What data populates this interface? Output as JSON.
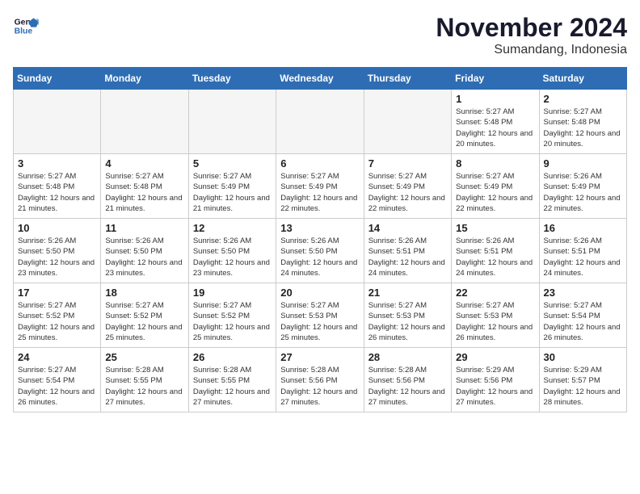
{
  "logo": {
    "line1": "General",
    "line2": "Blue"
  },
  "title": "November 2024",
  "subtitle": "Sumandang, Indonesia",
  "weekdays": [
    "Sunday",
    "Monday",
    "Tuesday",
    "Wednesday",
    "Thursday",
    "Friday",
    "Saturday"
  ],
  "weeks": [
    [
      {
        "day": "",
        "info": ""
      },
      {
        "day": "",
        "info": ""
      },
      {
        "day": "",
        "info": ""
      },
      {
        "day": "",
        "info": ""
      },
      {
        "day": "",
        "info": ""
      },
      {
        "day": "1",
        "info": "Sunrise: 5:27 AM\nSunset: 5:48 PM\nDaylight: 12 hours\nand 20 minutes."
      },
      {
        "day": "2",
        "info": "Sunrise: 5:27 AM\nSunset: 5:48 PM\nDaylight: 12 hours\nand 20 minutes."
      }
    ],
    [
      {
        "day": "3",
        "info": "Sunrise: 5:27 AM\nSunset: 5:48 PM\nDaylight: 12 hours\nand 21 minutes."
      },
      {
        "day": "4",
        "info": "Sunrise: 5:27 AM\nSunset: 5:48 PM\nDaylight: 12 hours\nand 21 minutes."
      },
      {
        "day": "5",
        "info": "Sunrise: 5:27 AM\nSunset: 5:49 PM\nDaylight: 12 hours\nand 21 minutes."
      },
      {
        "day": "6",
        "info": "Sunrise: 5:27 AM\nSunset: 5:49 PM\nDaylight: 12 hours\nand 22 minutes."
      },
      {
        "day": "7",
        "info": "Sunrise: 5:27 AM\nSunset: 5:49 PM\nDaylight: 12 hours\nand 22 minutes."
      },
      {
        "day": "8",
        "info": "Sunrise: 5:27 AM\nSunset: 5:49 PM\nDaylight: 12 hours\nand 22 minutes."
      },
      {
        "day": "9",
        "info": "Sunrise: 5:26 AM\nSunset: 5:49 PM\nDaylight: 12 hours\nand 22 minutes."
      }
    ],
    [
      {
        "day": "10",
        "info": "Sunrise: 5:26 AM\nSunset: 5:50 PM\nDaylight: 12 hours\nand 23 minutes."
      },
      {
        "day": "11",
        "info": "Sunrise: 5:26 AM\nSunset: 5:50 PM\nDaylight: 12 hours\nand 23 minutes."
      },
      {
        "day": "12",
        "info": "Sunrise: 5:26 AM\nSunset: 5:50 PM\nDaylight: 12 hours\nand 23 minutes."
      },
      {
        "day": "13",
        "info": "Sunrise: 5:26 AM\nSunset: 5:50 PM\nDaylight: 12 hours\nand 24 minutes."
      },
      {
        "day": "14",
        "info": "Sunrise: 5:26 AM\nSunset: 5:51 PM\nDaylight: 12 hours\nand 24 minutes."
      },
      {
        "day": "15",
        "info": "Sunrise: 5:26 AM\nSunset: 5:51 PM\nDaylight: 12 hours\nand 24 minutes."
      },
      {
        "day": "16",
        "info": "Sunrise: 5:26 AM\nSunset: 5:51 PM\nDaylight: 12 hours\nand 24 minutes."
      }
    ],
    [
      {
        "day": "17",
        "info": "Sunrise: 5:27 AM\nSunset: 5:52 PM\nDaylight: 12 hours\nand 25 minutes."
      },
      {
        "day": "18",
        "info": "Sunrise: 5:27 AM\nSunset: 5:52 PM\nDaylight: 12 hours\nand 25 minutes."
      },
      {
        "day": "19",
        "info": "Sunrise: 5:27 AM\nSunset: 5:52 PM\nDaylight: 12 hours\nand 25 minutes."
      },
      {
        "day": "20",
        "info": "Sunrise: 5:27 AM\nSunset: 5:53 PM\nDaylight: 12 hours\nand 25 minutes."
      },
      {
        "day": "21",
        "info": "Sunrise: 5:27 AM\nSunset: 5:53 PM\nDaylight: 12 hours\nand 26 minutes."
      },
      {
        "day": "22",
        "info": "Sunrise: 5:27 AM\nSunset: 5:53 PM\nDaylight: 12 hours\nand 26 minutes."
      },
      {
        "day": "23",
        "info": "Sunrise: 5:27 AM\nSunset: 5:54 PM\nDaylight: 12 hours\nand 26 minutes."
      }
    ],
    [
      {
        "day": "24",
        "info": "Sunrise: 5:27 AM\nSunset: 5:54 PM\nDaylight: 12 hours\nand 26 minutes."
      },
      {
        "day": "25",
        "info": "Sunrise: 5:28 AM\nSunset: 5:55 PM\nDaylight: 12 hours\nand 27 minutes."
      },
      {
        "day": "26",
        "info": "Sunrise: 5:28 AM\nSunset: 5:55 PM\nDaylight: 12 hours\nand 27 minutes."
      },
      {
        "day": "27",
        "info": "Sunrise: 5:28 AM\nSunset: 5:56 PM\nDaylight: 12 hours\nand 27 minutes."
      },
      {
        "day": "28",
        "info": "Sunrise: 5:28 AM\nSunset: 5:56 PM\nDaylight: 12 hours\nand 27 minutes."
      },
      {
        "day": "29",
        "info": "Sunrise: 5:29 AM\nSunset: 5:56 PM\nDaylight: 12 hours\nand 27 minutes."
      },
      {
        "day": "30",
        "info": "Sunrise: 5:29 AM\nSunset: 5:57 PM\nDaylight: 12 hours\nand 28 minutes."
      }
    ]
  ]
}
